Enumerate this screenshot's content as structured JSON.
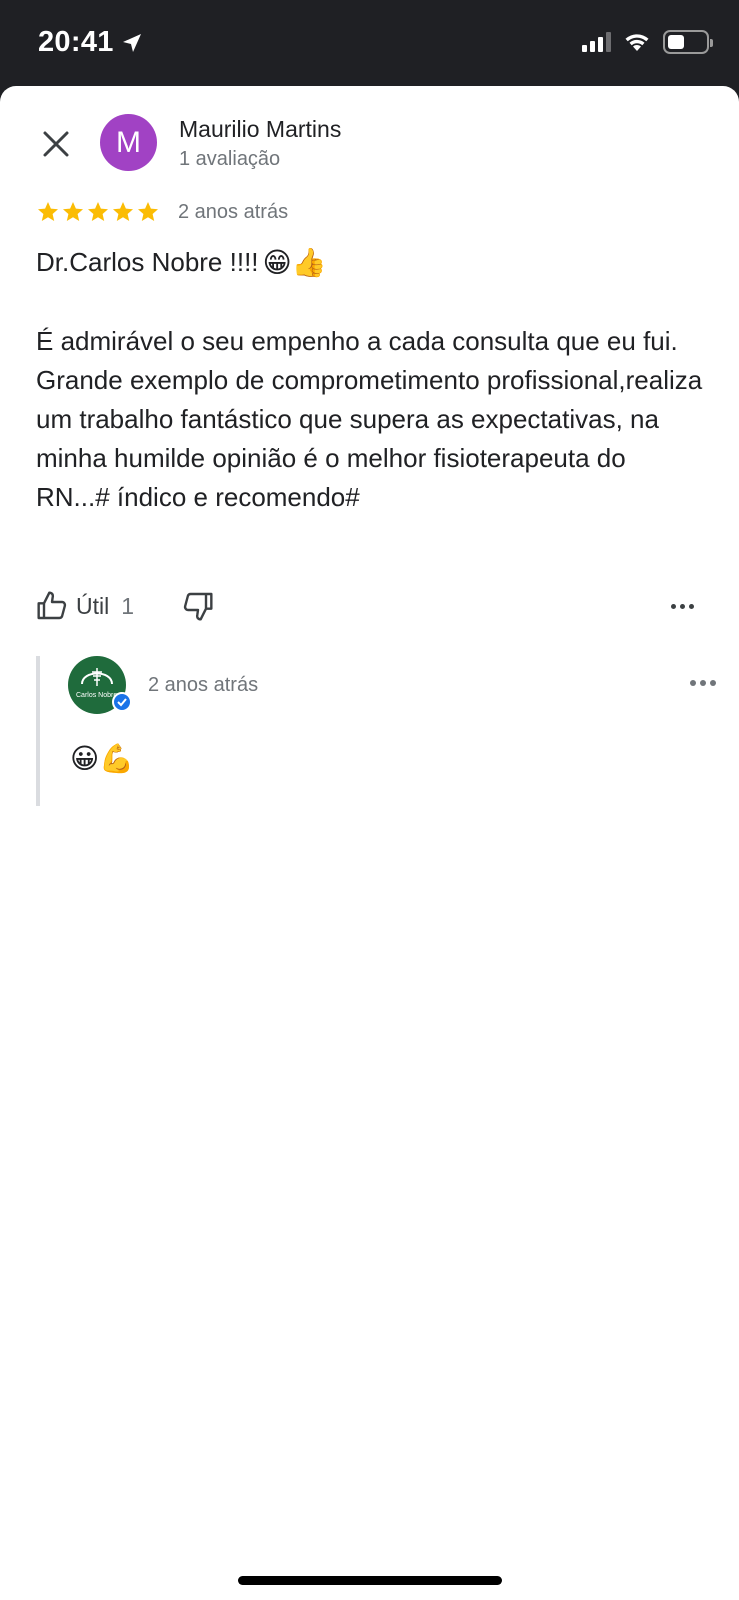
{
  "status_bar": {
    "time": "20:41"
  },
  "reviewer": {
    "avatar_letter": "M",
    "name": "Maurilio Martins",
    "meta": "1 avaliação"
  },
  "review": {
    "rating": 5,
    "time": "2 anos atrás",
    "title": "Dr.Carlos Nobre !!!!",
    "title_emojis": "😁👍",
    "body": "É admirável o seu empenho a cada consulta que eu fui. Grande exemplo de comprometimento profissional,realiza um trabalho fantástico que supera as expectativas, na minha humilde opinião é o melhor  fisioterapeuta do RN...# índico e recomendo#"
  },
  "actions": {
    "useful_label": "Útil",
    "useful_count": "1"
  },
  "owner_reply": {
    "logo_text": "Carlos Nobre",
    "time": "2 anos atrás",
    "text": "😀💪"
  },
  "colors": {
    "avatar": "#a142c4",
    "star": "#fbbc04",
    "owner_avatar": "#1f6b3c",
    "verified": "#1a73e8"
  },
  "icons": [
    "navigation-arrow-icon",
    "signal-icon",
    "wifi-icon",
    "battery-icon",
    "close-icon",
    "star-icon",
    "thumbs-up-icon",
    "thumbs-down-icon",
    "more-icon",
    "verified-icon"
  ]
}
